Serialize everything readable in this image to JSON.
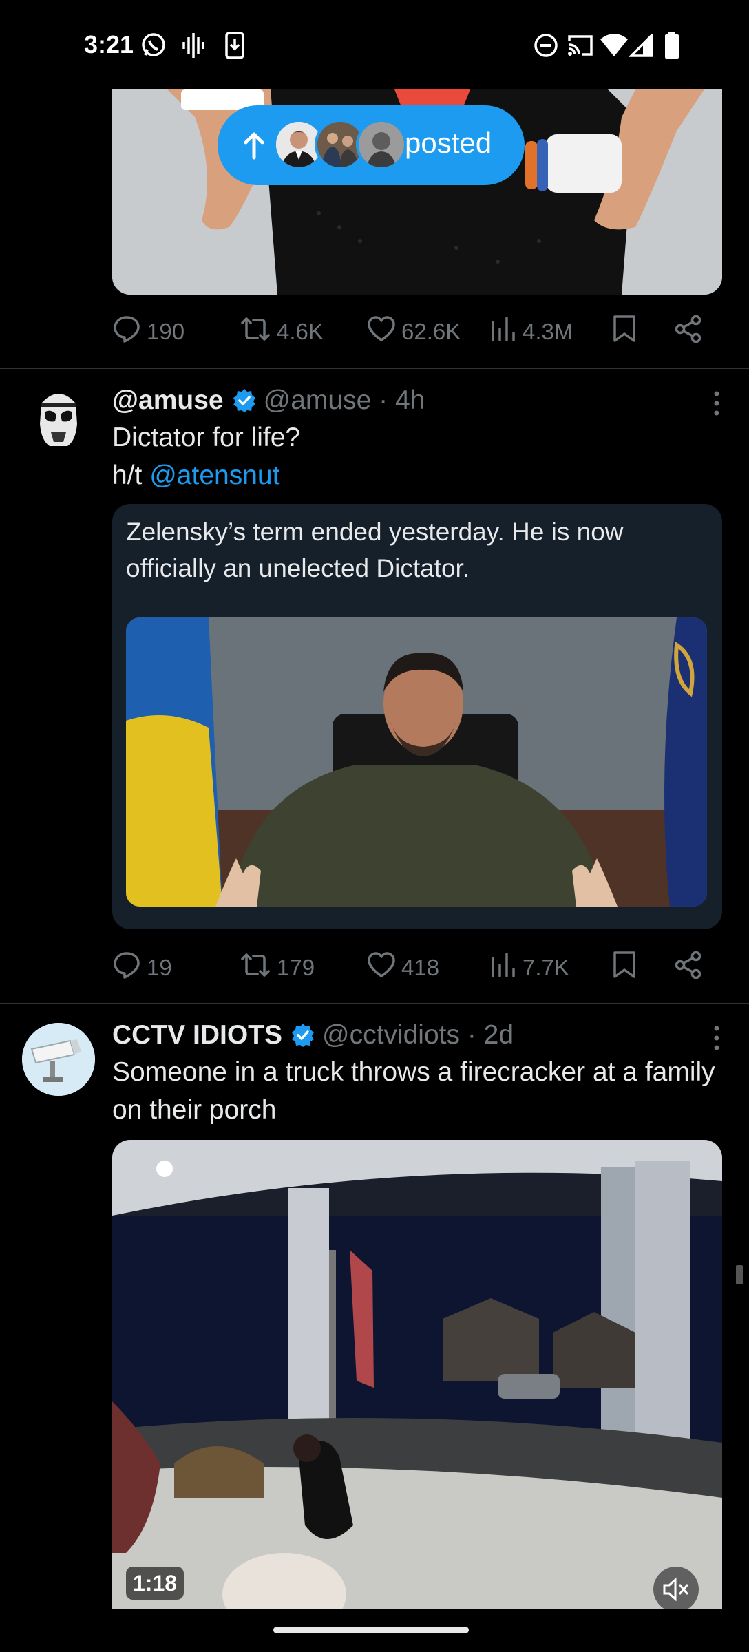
{
  "status_bar": {
    "time": "3:21",
    "left_icons": [
      "whatsapp-icon",
      "soundwave-icon",
      "download-icon"
    ],
    "right_icons": [
      "dnd-icon",
      "cast-icon",
      "wifi-icon",
      "signal-icon",
      "battery-icon"
    ]
  },
  "new_posts_pill": {
    "label": "posted",
    "icon": "arrow-up-icon"
  },
  "colors": {
    "accent": "#1d9bf0",
    "text": "#e7e9ea",
    "muted": "#71767b",
    "bg": "#000000"
  },
  "posts": [
    {
      "actions": {
        "replies": "190",
        "reposts": "4.6K",
        "likes": "62.6K",
        "views": "4.3M"
      }
    },
    {
      "display_name": "@amuse",
      "handle": "@amuse",
      "time": "4h",
      "text_line1": "Dictator for life?",
      "text_prefix": "h/t ",
      "mention": "@atensnut",
      "quote": {
        "text": "Zelensky’s term ended yesterday.  He is now officially an unelected Dictator."
      },
      "actions": {
        "replies": "19",
        "reposts": "179",
        "likes": "418",
        "views": "7.7K"
      }
    },
    {
      "display_name": "CCTV IDIOTS",
      "handle": "@cctvidiots",
      "time": "2d",
      "text": "Someone in a truck throws a firecracker at a family on their porch",
      "video": {
        "duration": "1:18",
        "muted": true
      }
    }
  ]
}
